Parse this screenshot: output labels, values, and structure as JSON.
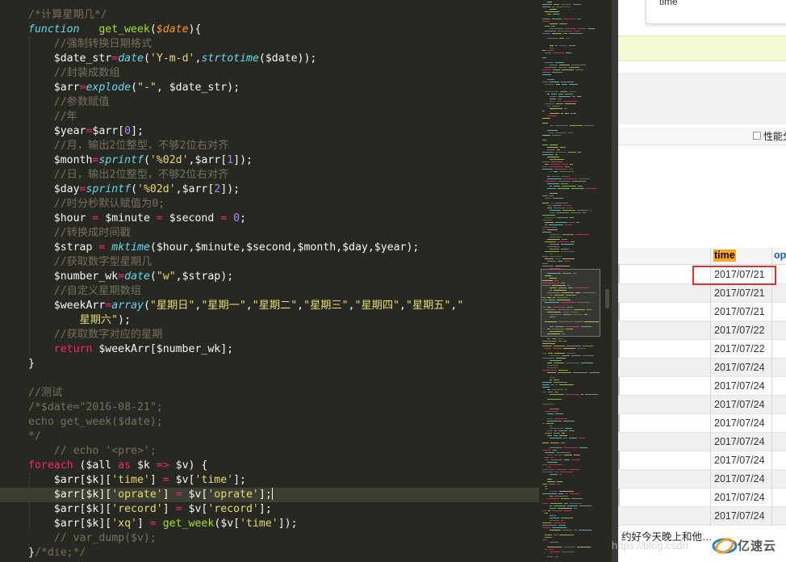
{
  "editor": {
    "lines": [
      [
        [
          "t-com",
          "/*计算星期几*/"
        ]
      ],
      [
        [
          "t-kwi",
          "function"
        ],
        [
          "t-pl",
          "   "
        ],
        [
          "t-fn",
          "get_week"
        ],
        [
          "t-pl",
          "("
        ],
        [
          "t-param",
          "$date"
        ],
        [
          "t-pl",
          "){"
        ]
      ],
      [
        [
          "t-pl",
          "    "
        ],
        [
          "t-com",
          "//强制转换日期格式"
        ]
      ],
      [
        [
          "t-pl",
          "    "
        ],
        [
          "t-var",
          "$date_str"
        ],
        [
          "t-op",
          "="
        ],
        [
          "t-kwi",
          "date"
        ],
        [
          "t-pl",
          "("
        ],
        [
          "t-str",
          "'Y-m-d'"
        ],
        [
          "t-pl",
          ","
        ],
        [
          "t-kwi",
          "strtotime"
        ],
        [
          "t-pl",
          "($date));"
        ]
      ],
      [
        [
          "t-pl",
          "    "
        ],
        [
          "t-com",
          "//封装成数组"
        ]
      ],
      [
        [
          "t-pl",
          "    "
        ],
        [
          "t-var",
          "$arr"
        ],
        [
          "t-op",
          "="
        ],
        [
          "t-kwi",
          "explode"
        ],
        [
          "t-pl",
          "("
        ],
        [
          "t-str",
          "\"-\""
        ],
        [
          "t-pl",
          ", $date_str);"
        ]
      ],
      [
        [
          "t-pl",
          "    "
        ],
        [
          "t-com",
          "//参数赋值"
        ]
      ],
      [
        [
          "t-pl",
          "    "
        ],
        [
          "t-com",
          "//年"
        ]
      ],
      [
        [
          "t-pl",
          "    "
        ],
        [
          "t-var",
          "$year"
        ],
        [
          "t-op",
          "="
        ],
        [
          "t-pl",
          "$arr["
        ],
        [
          "t-num",
          "0"
        ],
        [
          "t-pl",
          "];"
        ]
      ],
      [
        [
          "t-pl",
          "    "
        ],
        [
          "t-com",
          "//月，输出2位整型，不够2位右对齐"
        ]
      ],
      [
        [
          "t-pl",
          "    "
        ],
        [
          "t-var",
          "$month"
        ],
        [
          "t-op",
          "="
        ],
        [
          "t-kwi",
          "sprintf"
        ],
        [
          "t-pl",
          "("
        ],
        [
          "t-str",
          "'%02d'"
        ],
        [
          "t-pl",
          ",$arr["
        ],
        [
          "t-num",
          "1"
        ],
        [
          "t-pl",
          "]);"
        ]
      ],
      [
        [
          "t-pl",
          "    "
        ],
        [
          "t-com",
          "//日，输出2位整型，不够2位右对齐"
        ]
      ],
      [
        [
          "t-pl",
          "    "
        ],
        [
          "t-var",
          "$day"
        ],
        [
          "t-op",
          "="
        ],
        [
          "t-kwi",
          "sprintf"
        ],
        [
          "t-pl",
          "("
        ],
        [
          "t-str",
          "'%02d'"
        ],
        [
          "t-pl",
          ",$arr["
        ],
        [
          "t-num",
          "2"
        ],
        [
          "t-pl",
          "]);"
        ]
      ],
      [
        [
          "t-pl",
          "    "
        ],
        [
          "t-com",
          "//时分秒默认赋值为0;"
        ]
      ],
      [
        [
          "t-pl",
          "    "
        ],
        [
          "t-var",
          "$hour"
        ],
        [
          "t-pl",
          " "
        ],
        [
          "t-op",
          "="
        ],
        [
          "t-pl",
          " $minute "
        ],
        [
          "t-op",
          "="
        ],
        [
          "t-pl",
          " $second "
        ],
        [
          "t-op",
          "="
        ],
        [
          "t-pl",
          " "
        ],
        [
          "t-num",
          "0"
        ],
        [
          "t-pl",
          ";"
        ]
      ],
      [
        [
          "t-pl",
          "    "
        ],
        [
          "t-com",
          "//转换成时间戳"
        ]
      ],
      [
        [
          "t-pl",
          "    "
        ],
        [
          "t-var",
          "$strap"
        ],
        [
          "t-pl",
          " "
        ],
        [
          "t-op",
          "="
        ],
        [
          "t-pl",
          " "
        ],
        [
          "t-kwi",
          "mktime"
        ],
        [
          "t-pl",
          "($hour,$minute,$second,$month,$day,$year);"
        ]
      ],
      [
        [
          "t-pl",
          "    "
        ],
        [
          "t-com",
          "//获取数字型星期几"
        ]
      ],
      [
        [
          "t-pl",
          "    "
        ],
        [
          "t-var",
          "$number_wk"
        ],
        [
          "t-op",
          "="
        ],
        [
          "t-kwi",
          "date"
        ],
        [
          "t-pl",
          "("
        ],
        [
          "t-str",
          "\"w\""
        ],
        [
          "t-pl",
          ",$strap);"
        ]
      ],
      [
        [
          "t-pl",
          "    "
        ],
        [
          "t-com",
          "//自定义星期数组"
        ]
      ],
      [
        [
          "t-pl",
          "    "
        ],
        [
          "t-var",
          "$weekArr"
        ],
        [
          "t-op",
          "="
        ],
        [
          "t-kwi",
          "array"
        ],
        [
          "t-pl",
          "("
        ],
        [
          "t-str",
          "\"星期日\""
        ],
        [
          "t-pl",
          ","
        ],
        [
          "t-str",
          "\"星期一\""
        ],
        [
          "t-pl",
          ","
        ],
        [
          "t-str",
          "\"星期二\""
        ],
        [
          "t-pl",
          ","
        ],
        [
          "t-str",
          "\"星期三\""
        ],
        [
          "t-pl",
          ","
        ],
        [
          "t-str",
          "\"星期四\""
        ],
        [
          "t-pl",
          ","
        ],
        [
          "t-str",
          "\"星期五\""
        ],
        [
          "t-pl",
          ","
        ],
        [
          "t-str",
          "\""
        ]
      ],
      [
        [
          "t-pl",
          "        "
        ],
        [
          "t-str",
          "星期六\""
        ],
        [
          "t-pl",
          ");"
        ]
      ],
      [
        [
          "t-pl",
          "    "
        ],
        [
          "t-com",
          "//获取数字对应的星期"
        ]
      ],
      [
        [
          "t-pl",
          "    "
        ],
        [
          "t-kw",
          "return"
        ],
        [
          "t-pl",
          " $weekArr[$number_wk];"
        ]
      ],
      [
        [
          "t-pl",
          "}"
        ]
      ],
      [],
      [
        [
          "t-com",
          "//测试"
        ]
      ],
      [
        [
          "t-com",
          "/*$date=\"2016-08-21\";"
        ]
      ],
      [
        [
          "t-com",
          "echo get_week($date);"
        ]
      ],
      [
        [
          "t-com",
          "*/"
        ]
      ],
      [
        [
          "t-pl",
          "    "
        ],
        [
          "t-com",
          "// echo '<pre>';"
        ]
      ],
      [
        [
          "t-kw",
          "foreach"
        ],
        [
          "t-pl",
          " ($all "
        ],
        [
          "t-kw",
          "as"
        ],
        [
          "t-pl",
          " $k "
        ],
        [
          "t-op",
          "=>"
        ],
        [
          "t-pl",
          " $v) {"
        ]
      ],
      [
        [
          "t-pl",
          "    $arr[$k]["
        ],
        [
          "t-str",
          "'time'"
        ],
        [
          "t-pl",
          "] "
        ],
        [
          "t-op",
          "="
        ],
        [
          "t-pl",
          " $v["
        ],
        [
          "t-str",
          "'time'"
        ],
        [
          "t-pl",
          "];"
        ]
      ],
      [
        [
          "t-pl",
          "    $arr[$k]["
        ],
        [
          "t-str",
          "'oprate'"
        ],
        [
          "t-pl",
          "] "
        ],
        [
          "t-op",
          "="
        ],
        [
          "t-pl",
          " $v["
        ],
        [
          "t-str",
          "'oprate'"
        ],
        [
          "t-pl",
          "];"
        ]
      ],
      [
        [
          "t-pl",
          "    $arr[$k]["
        ],
        [
          "t-str",
          "'record'"
        ],
        [
          "t-pl",
          "] "
        ],
        [
          "t-op",
          "="
        ],
        [
          "t-pl",
          " $v["
        ],
        [
          "t-str",
          "'record'"
        ],
        [
          "t-pl",
          "];"
        ]
      ],
      [
        [
          "t-pl",
          "    $arr[$k]["
        ],
        [
          "t-str",
          "'xq'"
        ],
        [
          "t-pl",
          "] "
        ],
        [
          "t-op",
          "="
        ],
        [
          "t-pl",
          " "
        ],
        [
          "t-fn",
          "get_week"
        ],
        [
          "t-pl",
          "($v["
        ],
        [
          "t-str",
          "'time'"
        ],
        [
          "t-pl",
          "]);"
        ]
      ],
      [
        [
          "t-pl",
          "    "
        ],
        [
          "t-com",
          "// var_dump($v);"
        ]
      ],
      [
        [
          "t-pl",
          "}"
        ],
        [
          "t-com",
          "/*die;*/"
        ]
      ]
    ]
  },
  "panel": {
    "tooltip_text": "time",
    "perf_label": "性能分",
    "columns": {
      "time": "time",
      "op": "op"
    },
    "rows": [
      "2017/07/21",
      "2017/07/21",
      "2017/07/21",
      "2017/07/22",
      "2017/07/22",
      "2017/07/24",
      "2017/07/24",
      "2017/07/24",
      "2017/07/24",
      "2017/07/24",
      "2017/07/24",
      "2017/07/24",
      "2017/07/24",
      "2017/07/24"
    ],
    "footer_text": "约好今天晚上和他…"
  },
  "watermark": "https://blog.csdn",
  "logo_text": "亿速云",
  "colors": {
    "editor_bg": "#272822",
    "highlight_box": "#e0302b",
    "header_highlight": "#f5a623"
  }
}
